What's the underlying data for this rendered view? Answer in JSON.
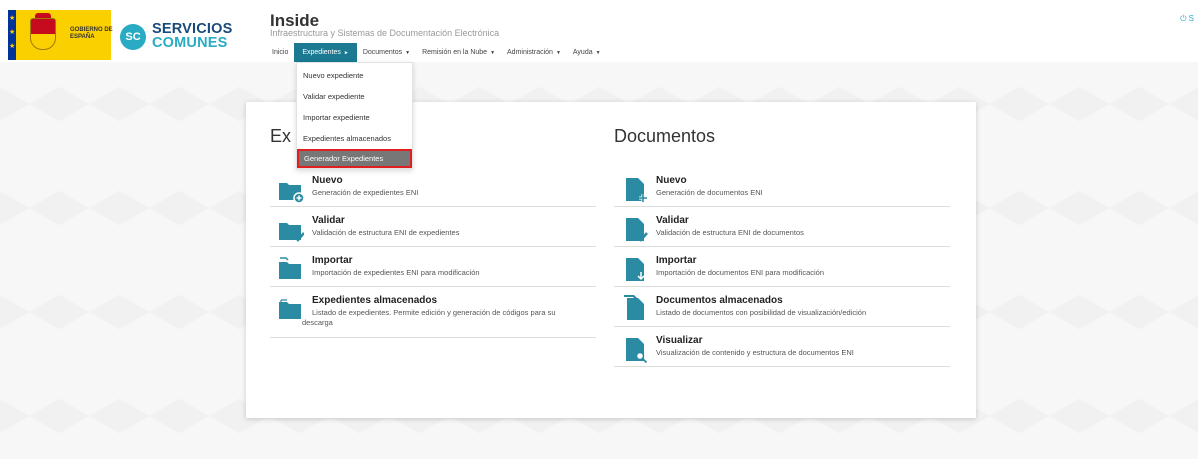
{
  "header": {
    "gov_logo_text": "GOBIERNO DE ESPAÑA",
    "brand_line1": "SERVICIOS",
    "brand_line2": "COMUNES",
    "brand_badge": "SC",
    "app_title": "Inside",
    "app_subtitle": "Infraestructura y Sistemas de Documentación Electrónica",
    "logout_label": "⏻ S"
  },
  "nav": {
    "items": [
      {
        "label": "Inicio"
      },
      {
        "label": "Expedientes",
        "caret": "►"
      },
      {
        "label": "Documentos",
        "caret": "▼"
      },
      {
        "label": "Remisión en la Nube",
        "caret": "▼"
      },
      {
        "label": "Administración",
        "caret": "▼"
      },
      {
        "label": "Ayuda",
        "caret": "▼"
      }
    ]
  },
  "dropdown": {
    "items": [
      {
        "label": "Nuevo expediente"
      },
      {
        "label": "Validar expediente"
      },
      {
        "label": "Importar expediente"
      },
      {
        "label": "Expedientes almacenados"
      },
      {
        "label": "Generador Expedientes"
      }
    ]
  },
  "expedientes": {
    "title_visible": "Ex",
    "items": [
      {
        "title": "Nuevo",
        "desc": "Generación de expedientes ENI",
        "icon": "folder-plus-icon"
      },
      {
        "title": "Validar",
        "desc": "Validación de estructura ENI de expedientes",
        "icon": "folder-check-icon"
      },
      {
        "title": "Importar",
        "desc": "Importación de expedientes ENI para modificación",
        "icon": "folder-import-icon"
      },
      {
        "title": "Expedientes almacenados",
        "desc": "Listado de expedientes. Permite edición y generación de códigos para su",
        "desc2": "descarga",
        "icon": "folder-stack-icon"
      }
    ]
  },
  "documentos": {
    "title": "Documentos",
    "items": [
      {
        "title": "Nuevo",
        "desc": "Generación de documentos ENI",
        "icon": "document-plus-icon"
      },
      {
        "title": "Validar",
        "desc": "Validación de estructura ENI de documentos",
        "icon": "document-check-icon"
      },
      {
        "title": "Importar",
        "desc": "Importación de documentos ENI para modificación",
        "icon": "document-import-icon"
      },
      {
        "title": "Documentos almacenados",
        "desc": "Listado de documentos con posibilidad de visualización/edición",
        "icon": "document-stack-icon"
      },
      {
        "title": "Visualizar",
        "desc": "Visualización de contenido y estructura de documentos ENI",
        "icon": "document-search-icon"
      }
    ]
  },
  "colors": {
    "accent": "#1b7a91",
    "icon_teal": "#2a8ba3",
    "highlight_border": "#e02020"
  }
}
